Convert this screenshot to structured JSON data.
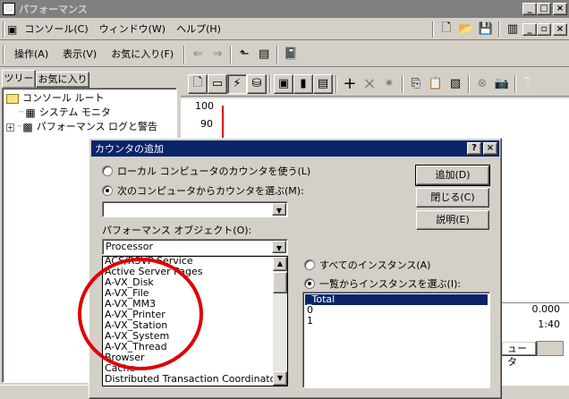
{
  "main_window": {
    "title": "パフォーマンス",
    "controls": [
      "_",
      "□",
      "×"
    ]
  },
  "menubar": {
    "items": [
      "コンソール(C)",
      "ウィンドウ(W)",
      "ヘルプ(H)"
    ],
    "mdi_controls": [
      "_",
      "▫",
      "×"
    ]
  },
  "actionbar": {
    "items": [
      "操作(A)",
      "表示(V)",
      "お気に入り(F)"
    ]
  },
  "left_tabs": [
    "ツリー",
    "お気に入り"
  ],
  "tree": {
    "root": "コンソール ルート",
    "children": [
      "システム モニタ",
      "パフォーマンス ログと警告"
    ]
  },
  "chart": {
    "y_ticks": [
      "100",
      "90"
    ],
    "readout_values": [
      "0.000",
      "1:40"
    ],
    "column_header": "ュータ"
  },
  "dialog": {
    "title": "カウンタの追加",
    "help_button": "?",
    "close_button": "×",
    "radio_local": "ローカル コンピュータのカウンタを使う(L)",
    "radio_select": "次のコンピュータからカウンタを選ぶ(M):",
    "computer_value": "",
    "perf_object_label": "パフォーマンス オブジェクト(O):",
    "perf_object_value": "Processor",
    "objects": [
      "ACS/RSVP Service",
      "Active Server Pages",
      "A-VX_Disk",
      "A-VX_File",
      "A-VX_MM3",
      "A-VX_Printer",
      "A-VX_Station",
      "A-VX_System",
      "A-VX_Thread",
      "Browser",
      "Cache",
      "Distributed Transaction Coordinator"
    ],
    "buttons": {
      "add": "追加(D)",
      "close": "閉じる(C)",
      "explain": "説明(E)"
    },
    "radio_all_instances": "すべてのインスタンス(A)",
    "radio_list_instances": "一覧からインスタンスを選ぶ(I):",
    "instances": [
      "_Total",
      "0",
      "1"
    ]
  },
  "colors": {
    "titlebar_active": "#0a246a",
    "annotation_circle": "#e00000",
    "face": "#d4d0c8"
  }
}
